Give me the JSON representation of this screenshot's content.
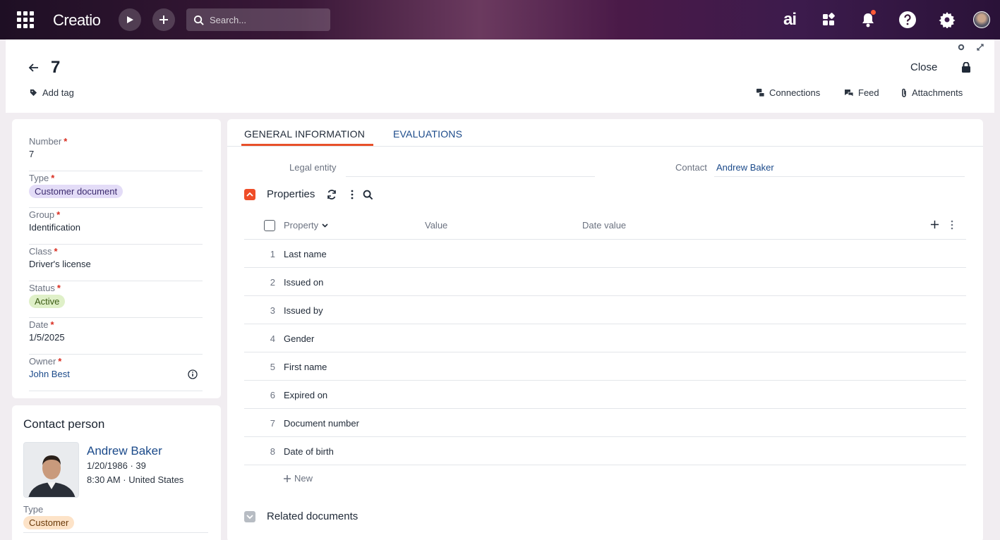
{
  "topbar": {
    "logo": "Creatio",
    "search_placeholder": "Search...",
    "ai_label": "ai"
  },
  "record": {
    "title": "7",
    "add_tag": "Add tag",
    "close": "Close",
    "actions": {
      "connections": "Connections",
      "feed": "Feed",
      "attachments": "Attachments"
    }
  },
  "fields": {
    "number": {
      "label": "Number",
      "value": "7"
    },
    "type": {
      "label": "Type",
      "value": "Customer document"
    },
    "group": {
      "label": "Group",
      "value": "Identification"
    },
    "class": {
      "label": "Class",
      "value": "Driver's license"
    },
    "status": {
      "label": "Status",
      "value": "Active"
    },
    "date": {
      "label": "Date",
      "value": "1/5/2025"
    },
    "owner": {
      "label": "Owner",
      "value": "John Best"
    },
    "required_mark": "*"
  },
  "contact_person": {
    "title": "Contact person",
    "name": "Andrew Baker",
    "birth": "1/20/1986 · 39",
    "time_location": "8:30 AM · United States",
    "type_label": "Type",
    "type_value": "Customer"
  },
  "tabs": [
    "GENERAL INFORMATION",
    "EVALUATIONS"
  ],
  "general": {
    "legal_entity_label": "Legal entity",
    "contact_label": "Contact",
    "contact_value": "Andrew Baker"
  },
  "properties": {
    "title": "Properties",
    "columns": {
      "property": "Property",
      "value": "Value",
      "date_value": "Date value"
    },
    "rows": [
      {
        "n": "1",
        "name": "Last name"
      },
      {
        "n": "2",
        "name": "Issued on"
      },
      {
        "n": "3",
        "name": "Issued by"
      },
      {
        "n": "4",
        "name": "Gender"
      },
      {
        "n": "5",
        "name": "First name"
      },
      {
        "n": "6",
        "name": "Expired on"
      },
      {
        "n": "7",
        "name": "Document number"
      },
      {
        "n": "8",
        "name": "Date of birth"
      }
    ],
    "new_label": "New"
  },
  "related_documents": {
    "title": "Related documents"
  },
  "colors": {
    "accent": "#e8502a",
    "link": "#1b4a8a",
    "type_chip_bg": "#e3dcf7",
    "status_chip_bg": "#dff0c8",
    "customer_chip_bg": "#fde3c8"
  }
}
